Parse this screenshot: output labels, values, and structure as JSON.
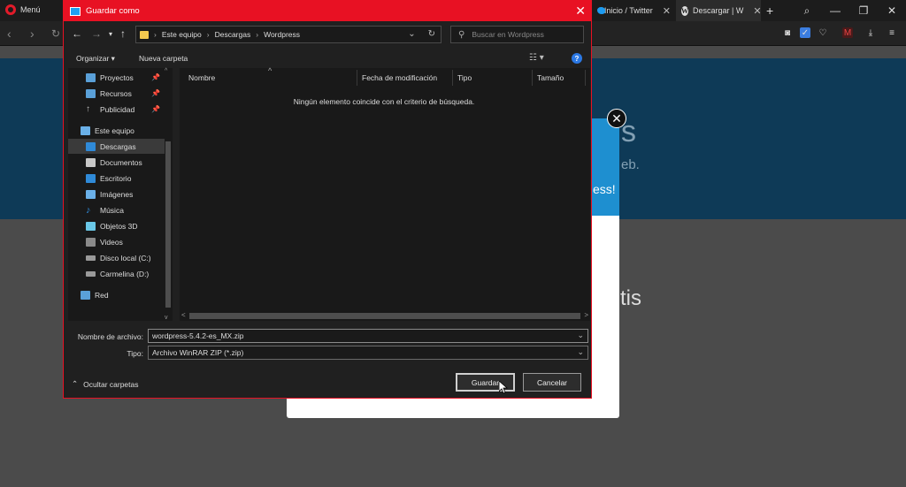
{
  "browser": {
    "menu_label": "Menú",
    "tabs": [
      {
        "label": "Inicio / Twitter",
        "icon": "twitter-icon"
      },
      {
        "label": "Descargar | W",
        "icon": "wordpress-icon",
        "active": true
      }
    ],
    "new_tab_symbol": "+",
    "accent_color": "#e21b2a"
  },
  "dialog": {
    "title": "Guardar como",
    "breadcrumb": [
      "Este equipo",
      "Descargas",
      "Wordpress"
    ],
    "search_placeholder": "Buscar en Wordpress",
    "toolbar": {
      "organize_label": "Organizar ▾",
      "new_folder_label": "Nueva carpeta"
    },
    "nav_items": [
      {
        "label": "Proyectos",
        "icon": "network-folder-icon",
        "color": "#5aa0d8",
        "pinned": true
      },
      {
        "label": "Recursos",
        "icon": "download-folder-icon",
        "color": "#5aa0d8",
        "pinned": true
      },
      {
        "label": "Publicidad",
        "icon": "arrow-up-icon",
        "color": "#bbbbbb",
        "pinned": true
      },
      {
        "label": "Este equipo",
        "icon": "computer-icon",
        "color": "#6ab0e8",
        "pinned": false
      },
      {
        "label": "Descargas",
        "icon": "downloads-icon",
        "color": "#2f8ad8",
        "pinned": false,
        "selected": true
      },
      {
        "label": "Documentos",
        "icon": "documents-icon",
        "color": "#c8c8c8",
        "pinned": false
      },
      {
        "label": "Escritorio",
        "icon": "desktop-icon",
        "color": "#2f8ad8",
        "pinned": false
      },
      {
        "label": "Imágenes",
        "icon": "pictures-icon",
        "color": "#6ab0e8",
        "pinned": false
      },
      {
        "label": "Música",
        "icon": "music-icon",
        "color": "#2f8ad8",
        "pinned": false
      },
      {
        "label": "Objetos 3D",
        "icon": "objects-3d-icon",
        "color": "#6ac8e8",
        "pinned": false
      },
      {
        "label": "Videos",
        "icon": "videos-icon",
        "color": "#8a8a8a",
        "pinned": false
      },
      {
        "label": "Disco local (C:)",
        "icon": "drive-c-icon",
        "color": "#9a9a9a",
        "pinned": false
      },
      {
        "label": "Carmelina (D:)",
        "icon": "drive-d-icon",
        "color": "#9a9a9a",
        "pinned": false
      },
      {
        "label": "Red",
        "icon": "network-icon",
        "color": "#5aa0d8",
        "pinned": false
      }
    ],
    "columns": [
      "Nombre",
      "Fecha de modificación",
      "Tipo",
      "Tamaño"
    ],
    "empty_message": "Ningún elemento coincide con el criterio de búsqueda.",
    "filename_label": "Nombre de archivo:",
    "filename_value": "wordpress-5.4.2-es_MX.zip",
    "type_label": "Tipo:",
    "type_value": "Archivo WinRAR ZIP (*.zip)",
    "hide_folders_label": "Ocultar carpetas",
    "save_label": "Guardar",
    "cancel_label": "Cancelar",
    "title_color": "#e81123"
  },
  "background_page": {
    "fragments": [
      "s",
      "eb.",
      "ess!",
      "tis"
    ],
    "close_symbol": "✕"
  }
}
